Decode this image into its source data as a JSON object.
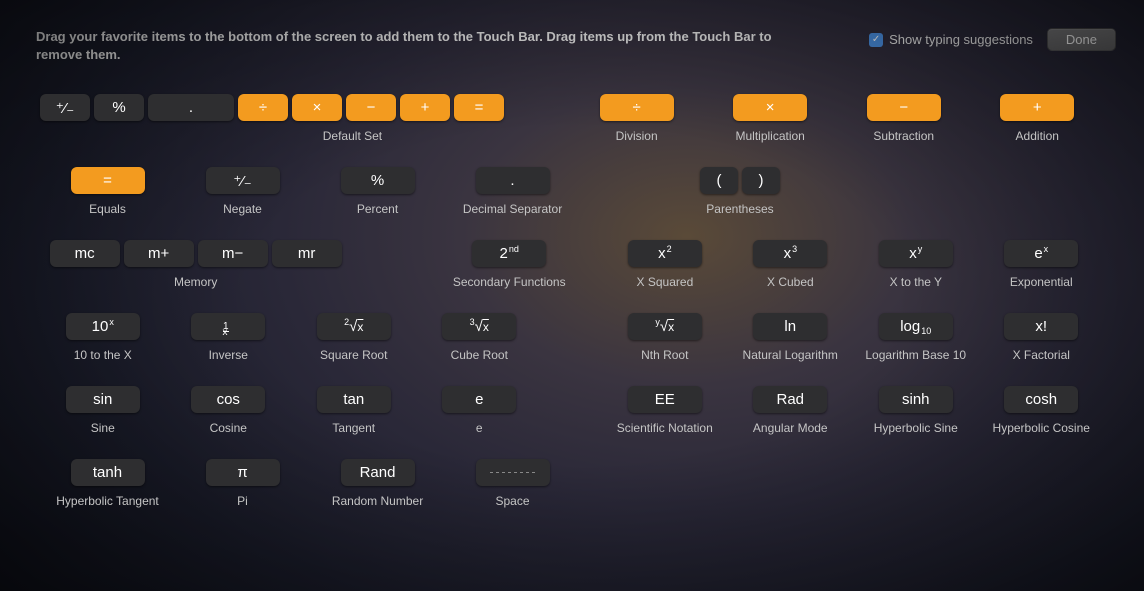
{
  "instructions": "Drag your favorite items to the bottom of the screen to add them to the Touch Bar. Drag items up from the Touch Bar to remove them.",
  "checkbox_label": "Show typing suggestions",
  "done": "Done",
  "labels": {
    "default_set": "Default Set",
    "division": "Division",
    "multiplication": "Multiplication",
    "subtraction": "Subtraction",
    "addition": "Addition",
    "equals": "Equals",
    "negate": "Negate",
    "percent": "Percent",
    "decimal_separator": "Decimal Separator",
    "parentheses": "Parentheses",
    "memory": "Memory",
    "secondary_functions": "Secondary Functions",
    "x_squared": "X Squared",
    "x_cubed": "X Cubed",
    "x_to_y": "X to the Y",
    "exponential": "Exponential",
    "ten_to_x": "10 to the X",
    "inverse": "Inverse",
    "square_root": "Square Root",
    "cube_root": "Cube Root",
    "nth_root": "Nth Root",
    "natural_log": "Natural Logarithm",
    "log10": "Logarithm Base 10",
    "x_factorial": "X Factorial",
    "sine": "Sine",
    "cosine": "Cosine",
    "tangent": "Tangent",
    "e": "e",
    "scientific": "Scientific Notation",
    "angular": "Angular Mode",
    "sinh": "Hyperbolic Sine",
    "cosh": "Hyperbolic Cosine",
    "tanh": "Hyperbolic Tangent",
    "pi": "Pi",
    "rand": "Random Number",
    "space": "Space"
  },
  "glyphs": {
    "negate": "⁺⁄₋",
    "percent": "%",
    "dot": ".",
    "divide": "÷",
    "multiply": "×",
    "minus": "−",
    "plus": "+",
    "equals": "=",
    "open_paren": "(",
    "close_paren": ")",
    "mc": "mc",
    "mplus": "m+",
    "mminus": "m−",
    "mr": "mr",
    "ln": "ln",
    "x_fact": "x!",
    "sin": "sin",
    "cos": "cos",
    "tan": "tan",
    "e": "e",
    "ee": "EE",
    "rad": "Rad",
    "sinh": "sinh",
    "cosh": "cosh",
    "tanh": "tanh",
    "pi": "π",
    "rand": "Rand"
  }
}
